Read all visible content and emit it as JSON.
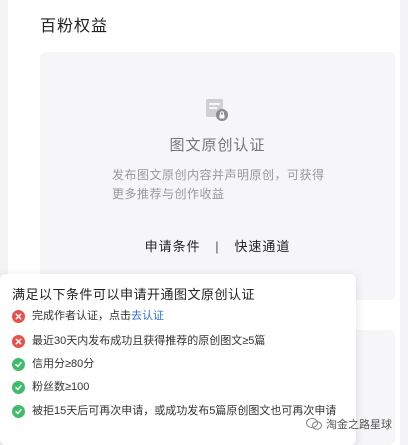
{
  "section": {
    "title": "百粉权益"
  },
  "card": {
    "title": "图文原创认证",
    "desc_line1": "发布图文原创内容并声明原创，可获得",
    "desc_line2": "更多推荐与创作收益",
    "link_apply": "申请条件",
    "separator": "|",
    "link_fast": "快速通道"
  },
  "popup": {
    "title": "满足以下条件可以申请开通图文原创认证",
    "conditions": [
      {
        "text": "完成作者认证，点击",
        "link": "去认证",
        "status": "fail"
      },
      {
        "text": "最近30天内发布成功且获得推荐的原创图文≥5篇",
        "status": "fail"
      },
      {
        "text": "信用分≥80分",
        "status": "pass"
      },
      {
        "text": "粉丝数≥100",
        "status": "pass"
      },
      {
        "text": "被拒15天后可再次申请，或成功发布5篇原创图文也可再次申请",
        "status": "pass"
      }
    ]
  },
  "watermark": {
    "text": "淘金之路星球"
  },
  "colors": {
    "fail": "#e8514a",
    "pass": "#3fbd6a",
    "link": "#2f6fd8"
  }
}
